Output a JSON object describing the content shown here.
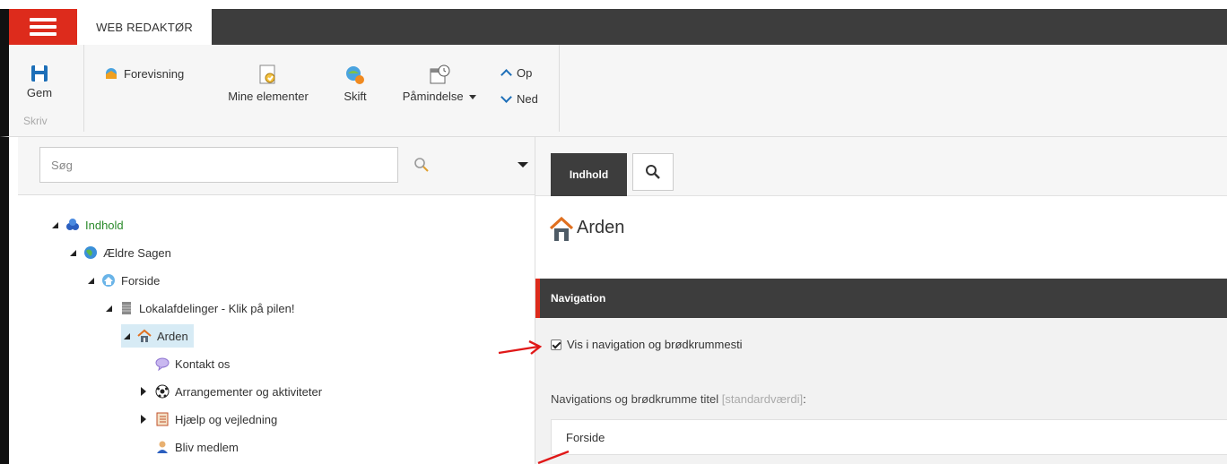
{
  "app": {
    "tab_label": "WEB REDAKTØR"
  },
  "ribbon": {
    "save_label": "Gem",
    "group_write": "Skriv",
    "preview_label": "Forevisning",
    "my_items_label": "Mine elementer",
    "switch_label": "Skift",
    "reminder_label": "Påmindelse",
    "up_label": "Op",
    "down_label": "Ned"
  },
  "search": {
    "placeholder": "Søg"
  },
  "tree": {
    "items": [
      {
        "label": "Indhold"
      },
      {
        "label": "Ældre Sagen"
      },
      {
        "label": "Forside"
      },
      {
        "label": "Lokalafdelinger - Klik på pilen!"
      },
      {
        "label": "Arden"
      },
      {
        "label": "Kontakt os"
      },
      {
        "label": "Arrangementer og aktiviteter"
      },
      {
        "label": "Hjælp og vejledning"
      },
      {
        "label": "Bliv medlem"
      }
    ]
  },
  "editor": {
    "tab_content": "Indhold",
    "page_title": "Arden",
    "section_title": "Navigation",
    "checkbox_label": "Vis i navigation og brødkrummesti",
    "field_label": "Navigations og brødkrumme titel",
    "field_hint": "[standardværdi]",
    "field_colon": ":",
    "field_value": "Forside"
  },
  "colors": {
    "accent_red": "#dd2b1c",
    "dark_bar": "#3d3d3d",
    "tree_selected": "#d7ebf5"
  }
}
